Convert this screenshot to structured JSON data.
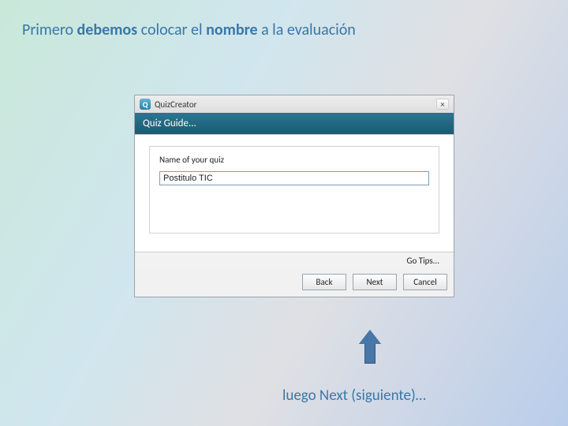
{
  "headings": {
    "top_prefix": "Primero ",
    "top_bold1": "debemos",
    "top_mid": " colocar el ",
    "top_bold2": "nombre",
    "top_suffix": " a la evaluación",
    "bottom": "luego Next (siguiente)…"
  },
  "dialog": {
    "app_icon_letter": "Q",
    "title": "QuizCreator",
    "close_label": "×",
    "subheader": "Quiz Guide...",
    "field_label": "Name of your quiz",
    "field_value": "Postitulo TIC",
    "tips_label": "Go Tips...",
    "buttons": {
      "back": "Back",
      "next": "Next",
      "cancel": "Cancel"
    }
  }
}
